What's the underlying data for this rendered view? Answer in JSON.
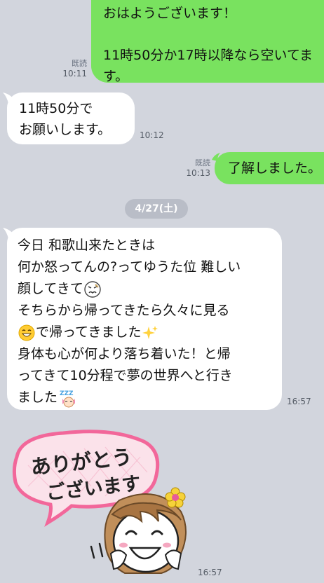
{
  "messages": [
    {
      "id": "m1",
      "side": "sent",
      "lines": [
        "おはようございます！",
        "",
        "11時50分か17時以降なら空いてま",
        "す。"
      ],
      "read": "既読",
      "time": "10:11"
    },
    {
      "id": "m2",
      "side": "received",
      "lines": [
        "11時50分で",
        "お願いします。"
      ],
      "time": "10:12"
    },
    {
      "id": "m3",
      "side": "sent",
      "lines": [
        "了解しました。"
      ],
      "read": "既読",
      "time": "10:13"
    },
    {
      "id": "m4",
      "side": "received",
      "lines": [
        "今日 和歌山来たときは",
        "何か怒ってんの?ってゆうた位 難しい",
        "顔してきて",
        "そちらから帰ってきたら久々に見る",
        "で帰ってきました",
        "身体も心が何より落ち着いた！と帰",
        "ってきて10分程で夢の世界へと行き",
        "ました"
      ],
      "emojis": [
        "confounded-face-emoji",
        "grinning-face-emoji",
        "sparkles-emoji",
        "sleeping-zzz-emoji"
      ],
      "time": "16:57"
    }
  ],
  "date_separator": "4/27(土)",
  "sticker": {
    "text_line1": "ありがとう",
    "text_line2": "ございます",
    "time": "16:57"
  },
  "colors": {
    "background": "#d2d5dd",
    "sent_bubble": "#79e25f",
    "received_bubble": "#ffffff"
  }
}
